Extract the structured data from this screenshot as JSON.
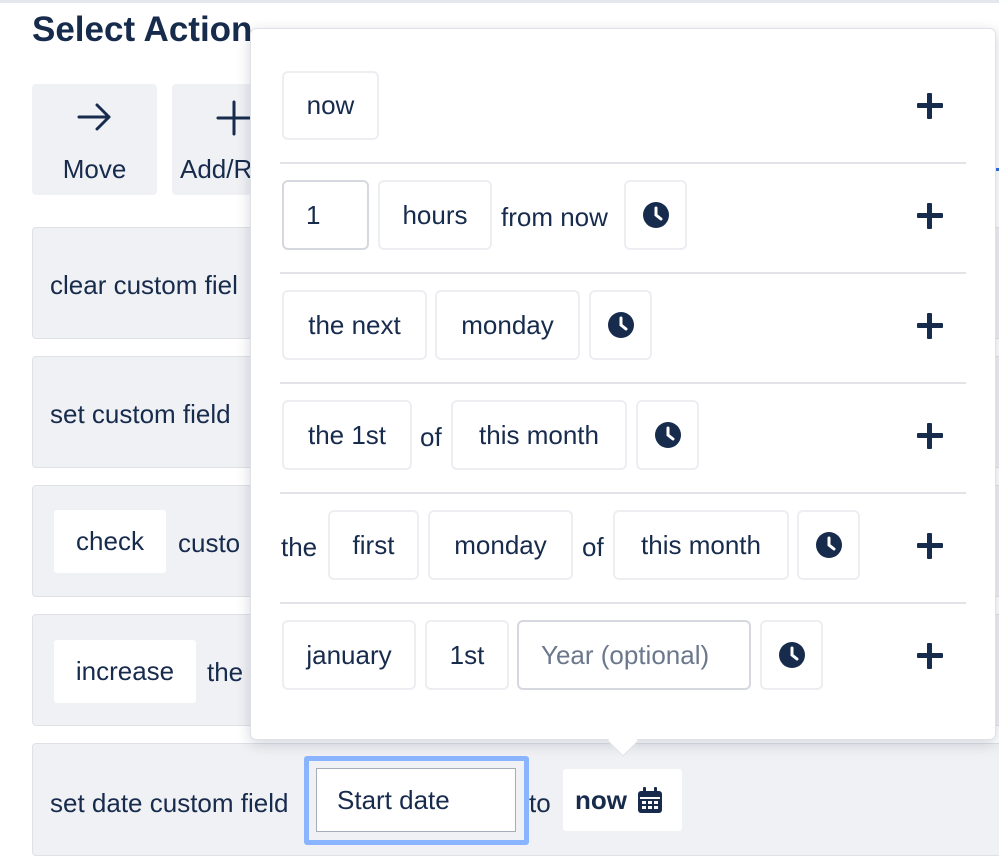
{
  "page_title": "Select Action",
  "action_tiles": [
    {
      "label": "Move",
      "icon": "arrow-right-icon"
    },
    {
      "label": "Add/R",
      "icon": "plus-icon"
    }
  ],
  "action_cards": {
    "clear": {
      "text": "clear custom fiel"
    },
    "set": {
      "text": "set custom field"
    },
    "check": {
      "chip": "check",
      "text": "custo"
    },
    "increase": {
      "chip": "increase",
      "text": "the"
    },
    "set_date": {
      "prefix": "set date custom field",
      "field_value": "Start date",
      "to_text": "to",
      "date_value": "now",
      "icon": "calendar-icon"
    }
  },
  "date_picker": {
    "rows": [
      {
        "option": "now"
      },
      {
        "amount": "1",
        "unit": "hours",
        "text": "from now"
      },
      {
        "prefix": "the next",
        "day": "monday"
      },
      {
        "ordinal": "the 1st",
        "of_text": "of",
        "period": "this month"
      },
      {
        "lead": "the",
        "which": "first",
        "day": "monday",
        "of_text": "of",
        "period": "this month"
      },
      {
        "month": "january",
        "day": "1st",
        "year_placeholder": "Year (optional)"
      }
    ],
    "icons": {
      "time": "clock-icon",
      "add": "plus-icon"
    }
  },
  "colors": {
    "text": "#172b4d",
    "card_bg": "#f0f1f4",
    "focus_ring": "#8bb4ff",
    "placeholder": "#6b778c"
  }
}
